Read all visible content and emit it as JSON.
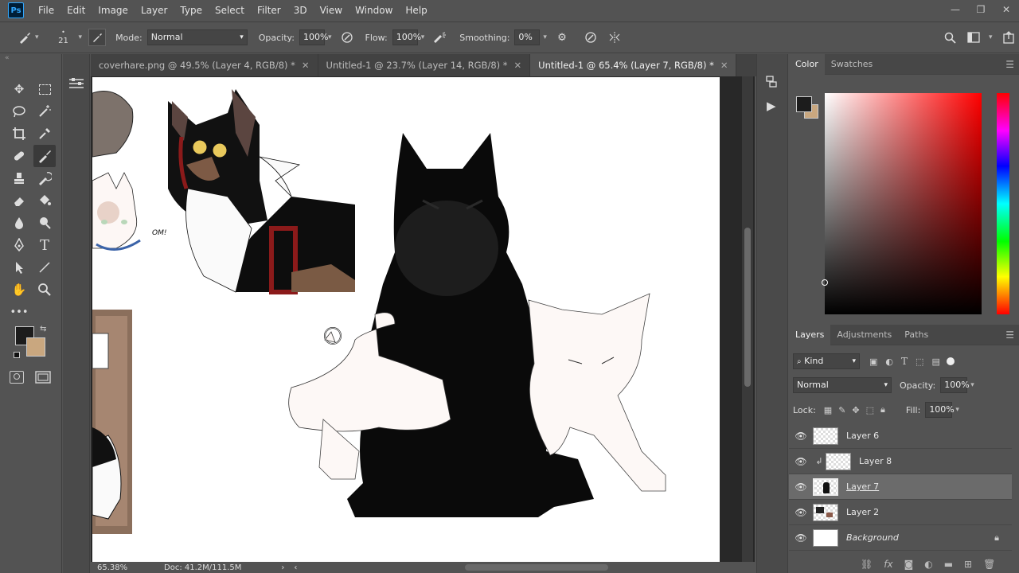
{
  "menubar": {
    "items": [
      "File",
      "Edit",
      "Image",
      "Layer",
      "Type",
      "Select",
      "Filter",
      "3D",
      "View",
      "Window",
      "Help"
    ],
    "logo": "Ps"
  },
  "options": {
    "brush_size": "21",
    "mode_label": "Mode:",
    "mode_value": "Normal",
    "opacity_label": "Opacity:",
    "opacity_value": "100%",
    "flow_label": "Flow:",
    "flow_value": "100%",
    "smoothing_label": "Smoothing:",
    "smoothing_value": "0%"
  },
  "tabs": [
    {
      "label": "coverhare.png @ 49.5% (Layer 4, RGB/8) *"
    },
    {
      "label": "Untitled-1 @ 23.7% (Layer 14, RGB/8) *"
    },
    {
      "label": "Untitled-1 @ 65.4% (Layer 7, RGB/8) *"
    }
  ],
  "status": {
    "zoom": "65.38%",
    "doc": "Doc: 41.2M/111.5M"
  },
  "color_panel": {
    "tabs": [
      "Color",
      "Swatches"
    ],
    "foreground": "#1c1c1c",
    "background": "#c9a77f"
  },
  "layers_panel": {
    "tabs": [
      "Layers",
      "Adjustments",
      "Paths"
    ],
    "filter_kind": "Kind",
    "blend_mode": "Normal",
    "opacity_label": "Opacity:",
    "opacity_value": "100%",
    "lock_label": "Lock:",
    "fill_label": "Fill:",
    "fill_value": "100%",
    "layers": [
      {
        "name": "Layer 6"
      },
      {
        "name": "Layer 8"
      },
      {
        "name": "Layer 7"
      },
      {
        "name": "Layer 2"
      },
      {
        "name": "Background"
      }
    ]
  },
  "canvas_text": {
    "speech": "OM!"
  },
  "colors": {
    "ui_bg": "#535353",
    "accent": "#31a8ff"
  }
}
